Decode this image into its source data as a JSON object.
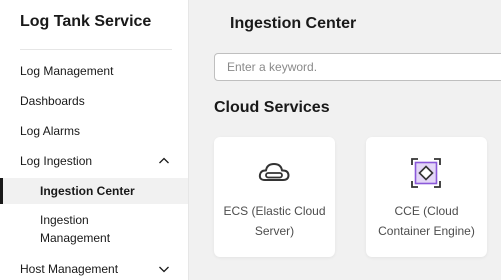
{
  "sidebar": {
    "brand": "Log Tank Service",
    "items": [
      {
        "label": "Log Management"
      },
      {
        "label": "Dashboards"
      },
      {
        "label": "Log Alarms"
      },
      {
        "label": "Log Ingestion"
      },
      {
        "label": "Host Management"
      }
    ],
    "sub_items": [
      {
        "label": "Ingestion Center"
      },
      {
        "label": "Ingestion Management"
      }
    ]
  },
  "main": {
    "title": "Ingestion Center",
    "search": {
      "placeholder": "Enter a keyword."
    },
    "section_title": "Cloud Services",
    "cards": [
      {
        "label": "ECS (Elastic Cloud Server)",
        "icon": "ecs-cloud-icon"
      },
      {
        "label": "CCE (Cloud Container Engine)",
        "icon": "cce-container-icon"
      }
    ]
  },
  "colors": {
    "background": "#f1f1f1",
    "text": "#191919",
    "cce_icon": "#8b59d9"
  }
}
